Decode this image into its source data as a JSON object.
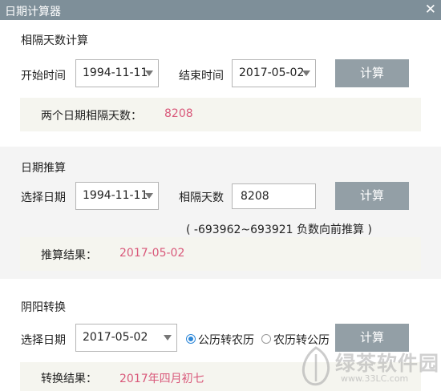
{
  "window": {
    "title": "日期计算器",
    "close_glyph": "✕"
  },
  "section1": {
    "title": "相隔天数计算",
    "start_label": "开始时间",
    "start_value": "1994-11-11",
    "end_label": "结束时间",
    "end_value": "2017-05-02",
    "button": "计算",
    "result_label": "两个日期相隔天数：",
    "result_value": "8208"
  },
  "section2": {
    "title": "日期推算",
    "date_label": "选择日期",
    "date_value": "1994-11-11",
    "days_label": "相隔天数",
    "days_value": "8208",
    "button": "计算",
    "hint": "( -693962~693921 负数向前推算 )",
    "result_label": "推算结果：",
    "result_value": "2017-05-02"
  },
  "section3": {
    "title": "阴阳转换",
    "date_label": "选择日期",
    "date_value": "2017-05-02",
    "radio_solar_to_lunar": "公历转农历",
    "radio_lunar_to_solar": "农历转公历",
    "selected": "solar_to_lunar",
    "button": "计算",
    "result_label": "转换结果：",
    "result_value": "2017年四月初七"
  },
  "watermark": {
    "text": "绿茶软件园",
    "url": "www.33LC.com"
  },
  "colors": {
    "titlebar": "#7e8f99",
    "button": "#939fa6",
    "result": "#d9587a",
    "radio": "#2d87d8"
  }
}
